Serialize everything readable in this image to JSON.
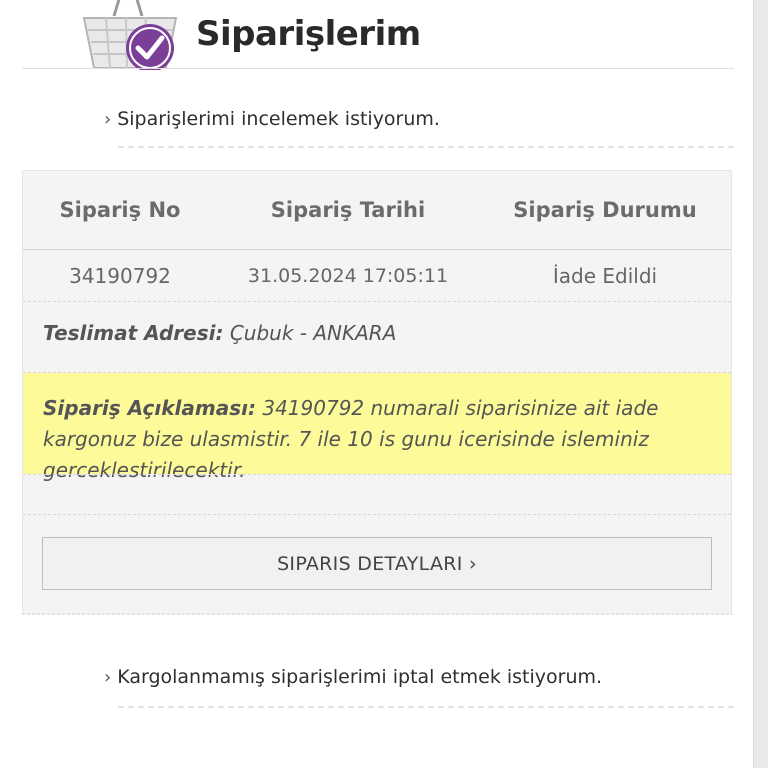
{
  "header": {
    "title": "Siparişlerim"
  },
  "links": {
    "review_orders": "Siparişlerimi incelemek istiyorum.",
    "cancel_orders": "Kargolanmamış siparişlerimi iptal etmek istiyorum.",
    "chevron": "›"
  },
  "orders_table": {
    "columns": [
      "Sipariş No",
      "Sipariş Tarihi",
      "Sipariş Durumu"
    ],
    "row": {
      "order_no": "34190792",
      "order_date": "31.05.2024 17:05:11",
      "status": "İade Edildi"
    }
  },
  "address": {
    "label": "Teslimat Adresi:",
    "value": "Çubuk - ANKARA"
  },
  "description": {
    "label": "Sipariş Açıklaması:",
    "text": "34190792 numarali siparisinize ait iade kargonuz bize ulasmistir. 7 ile 10 is gunu icerisinde isleminiz gerceklestirilecektir."
  },
  "detail_button": {
    "label": "SIPARIS DETAYLARI ›"
  },
  "colors": {
    "highlight": "#fdfb99",
    "badge_purple": "#7b3f98",
    "card_bg": "#f4f4f4"
  },
  "icons": {
    "header": "shopping-basket-check-icon"
  }
}
